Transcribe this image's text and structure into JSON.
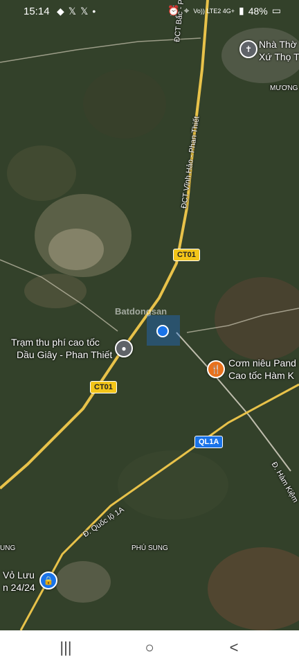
{
  "status_bar": {
    "time": "15:14",
    "notif_icons": [
      "game-icon",
      "x-icon",
      "x-icon",
      "dot-icon"
    ],
    "network": "Vo)) LTE2 4G+",
    "battery": "48%"
  },
  "map": {
    "road_labels": {
      "dct_top": "ĐCT Bắc - Phan Thiết",
      "dct_mid": "ĐCT Vĩnh Hảo - Phan Thiết",
      "quoc_lo": "Đ. Quốc lộ 1A",
      "ham_kiem": "Đ. Hàm Kiệm"
    },
    "shields": {
      "ct01_top": "CT01",
      "ct01_bottom": "CT01",
      "ql1a": "QL1A"
    },
    "places": {
      "church_line1": "Nhà Thờ",
      "church_line2": "Xứ Thọ T",
      "muong": "MƯƠNG",
      "toll_line1": "Trạm thu phí cao tốc",
      "toll_line2": "Dầu Giây - Phan Thiết",
      "food_line1": "Cơm niêu Pand",
      "food_line2": "Cao tốc Hàm K",
      "phu_sung": "PHÚ SUNG",
      "vo_luu_line1": "Vỏ Lưu",
      "vo_luu_line2": "n 24/24",
      "ung": "UNG"
    },
    "watermark": "Batdongsan",
    "colors": {
      "highway": "#e8c24a",
      "road": "#d8d4c4",
      "accent_blue": "#1a73e8",
      "food_pin": "#e8711c",
      "toll_pin": "#5f6368"
    }
  },
  "nav_bar": {
    "recents": "|||",
    "home": "○",
    "back": "<"
  }
}
